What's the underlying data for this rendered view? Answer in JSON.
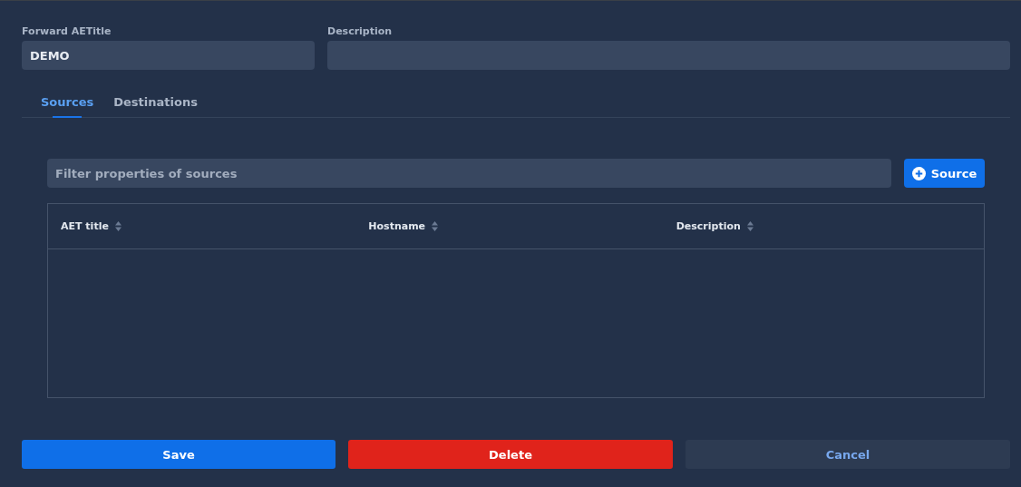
{
  "fields": [
    {
      "label": "Forward AETitle",
      "value": "DEMO"
    },
    {
      "label": "Description"
    }
  ],
  "tabs": [
    {
      "label": "Sources",
      "selected": true
    },
    {
      "label": "Destinations",
      "selected": false
    }
  ],
  "filter": {
    "placeholder": "Filter properties of sources"
  },
  "add_button": {
    "label": "Source"
  },
  "table": {
    "columns": [
      "AET title",
      "Hostname",
      "Description"
    ]
  },
  "buttons": [
    {
      "label": "Save",
      "kind": "primary"
    },
    {
      "label": "Delete",
      "kind": "danger"
    },
    {
      "label": "Cancel",
      "kind": "secondary"
    }
  ]
}
